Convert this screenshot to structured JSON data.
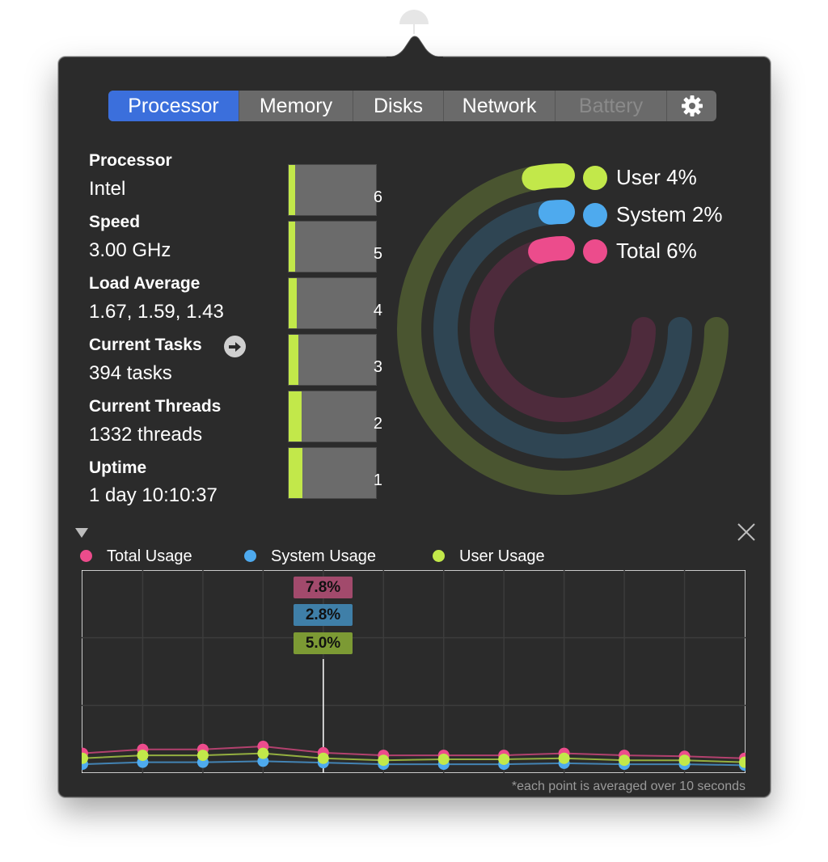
{
  "tabs": [
    {
      "label": "Processor",
      "state": "active"
    },
    {
      "label": "Memory",
      "state": "normal"
    },
    {
      "label": "Disks",
      "state": "normal"
    },
    {
      "label": "Network",
      "state": "normal"
    },
    {
      "label": "Battery",
      "state": "disabled"
    },
    {
      "label": "",
      "icon": "gear-icon"
    }
  ],
  "info": {
    "processor": {
      "label": "Processor",
      "value": "Intel"
    },
    "speed": {
      "label": "Speed",
      "value": "3.00 GHz"
    },
    "load": {
      "label": "Load Average",
      "value": "1.67, 1.59, 1.43"
    },
    "tasks": {
      "label": "Current Tasks",
      "value": "394 tasks"
    },
    "threads": {
      "label": "Current Threads",
      "value": "1332 threads"
    },
    "uptime": {
      "label": "Uptime",
      "value": "1 day 10:10:37"
    }
  },
  "cores": [
    {
      "label": "6",
      "usage": 0.07
    },
    {
      "label": "5",
      "usage": 0.07
    },
    {
      "label": "4",
      "usage": 0.09
    },
    {
      "label": "3",
      "usage": 0.11
    },
    {
      "label": "2",
      "usage": 0.15
    },
    {
      "label": "1",
      "usage": 0.16
    }
  ],
  "rings": {
    "user": {
      "label": "User 4%",
      "percent": 4,
      "color": "#c2e84a",
      "track": "#4a5530"
    },
    "system": {
      "label": "System 2%",
      "percent": 2,
      "color": "#4eaaee",
      "track": "#2f4553"
    },
    "total": {
      "label": "Total 6%",
      "percent": 6,
      "color": "#ec4c8c",
      "track": "#4e2b3c"
    }
  },
  "history": {
    "legend": [
      {
        "label": "Total Usage",
        "color": "#ec4c8c"
      },
      {
        "label": "System Usage",
        "color": "#4eaaee"
      },
      {
        "label": "User Usage",
        "color": "#c2e84a"
      }
    ],
    "tooltip": {
      "total": "7.8%",
      "system": "2.8%",
      "user": "5.0%"
    },
    "footnote": "*each point is averaged over 10 seconds"
  },
  "chart_data": {
    "type": "line",
    "ylim": [
      0,
      100
    ],
    "x": [
      1,
      2,
      3,
      4,
      5,
      6,
      7,
      8,
      9,
      10,
      11,
      12
    ],
    "series": [
      {
        "name": "Total Usage",
        "color": "#ec4c8c",
        "values": [
          7.5,
          9.5,
          9.5,
          11,
          7.8,
          6.5,
          6.5,
          6.5,
          7.5,
          6.5,
          6,
          5
        ]
      },
      {
        "name": "System Usage",
        "color": "#4eaaee",
        "values": [
          2,
          3,
          3,
          3.5,
          2.8,
          2,
          2,
          2,
          2.5,
          2,
          2,
          1.5
        ]
      },
      {
        "name": "User Usage",
        "color": "#c2e84a",
        "values": [
          5,
          6.5,
          6.5,
          7.5,
          5,
          4,
          4.5,
          4.5,
          5,
          4,
          4,
          3
        ]
      }
    ]
  }
}
